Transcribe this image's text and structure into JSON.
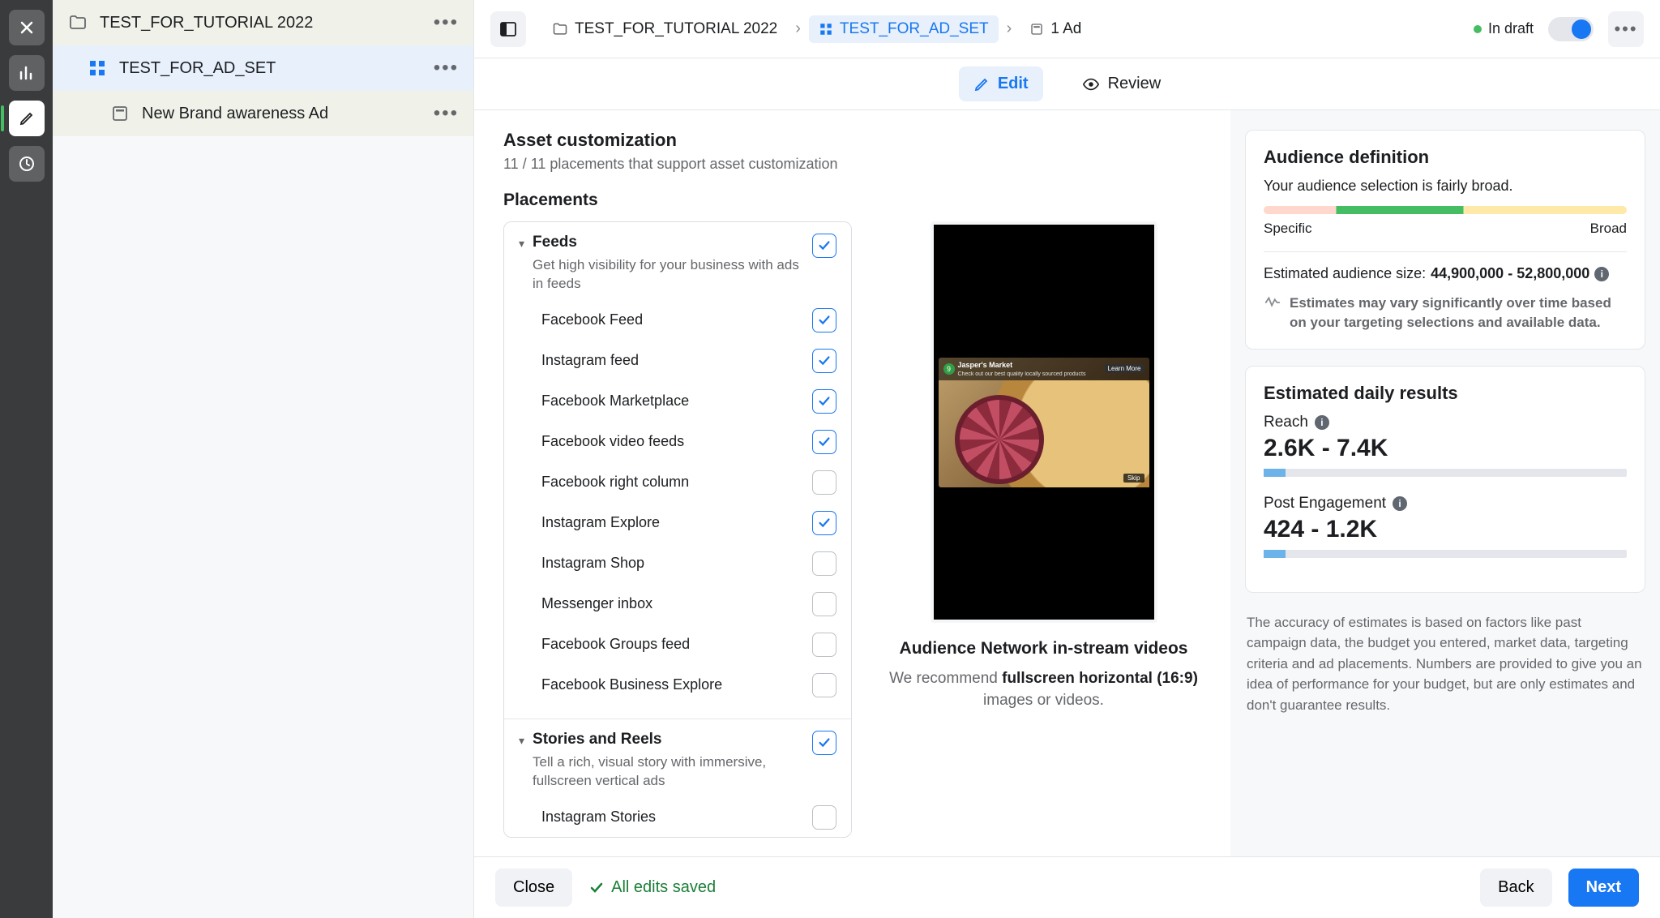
{
  "leftTree": {
    "campaign": "TEST_FOR_TUTORIAL 2022",
    "adset": "TEST_FOR_AD_SET",
    "ad": "New Brand awareness Ad"
  },
  "breadcrumb": {
    "campaign": "TEST_FOR_TUTORIAL 2022",
    "adset": "TEST_FOR_AD_SET",
    "ad": "1 Ad"
  },
  "status": {
    "label": "In draft"
  },
  "tabs": {
    "edit": "Edit",
    "review": "Review"
  },
  "section": {
    "title": "Asset customization",
    "sub": "11 / 11 placements that support asset customization",
    "placementsTitle": "Placements"
  },
  "groups": {
    "feeds": {
      "title": "Feeds",
      "desc": "Get high visibility for your business with ads in feeds",
      "items": {
        "fbFeed": "Facebook Feed",
        "igFeed": "Instagram feed",
        "fbMarketplace": "Facebook Marketplace",
        "fbVideoFeeds": "Facebook video feeds",
        "fbRightCol": "Facebook right column",
        "igExplore": "Instagram Explore",
        "igShop": "Instagram Shop",
        "msgInbox": "Messenger inbox",
        "fbGroups": "Facebook Groups feed",
        "fbBizExplore": "Facebook Business Explore"
      }
    },
    "stories": {
      "title": "Stories and Reels",
      "desc": "Tell a rich, visual story with immersive, fullscreen vertical ads",
      "items": {
        "igStories": "Instagram Stories"
      }
    }
  },
  "preview": {
    "title": "Audience Network in-stream videos",
    "hintPrefix": "We recommend ",
    "hintBold": "fullscreen horizontal (16:9)",
    "hintSuffix": " images or videos.",
    "brand": "Jasper's Market",
    "tagline": "Check out our best quality locally sourced products",
    "learnMore": "Learn More",
    "skip": "Skip"
  },
  "audience": {
    "title": "Audience definition",
    "note": "Your audience selection is fairly broad.",
    "specific": "Specific",
    "broad": "Broad",
    "estLabel": "Estimated audience size:",
    "estValue": "44,900,000 - 52,800,000",
    "warn": "Estimates may vary significantly over time based on your targeting selections and available data."
  },
  "results": {
    "title": "Estimated daily results",
    "reachLabel": "Reach",
    "reachValue": "2.6K - 7.4K",
    "engLabel": "Post Engagement",
    "engValue": "424 - 1.2K"
  },
  "disclaimer": "The accuracy of estimates is based on factors like past campaign data, the budget you entered, market data, targeting criteria and ad placements. Numbers are provided to give you an idea of performance for your budget, but are only estimates and don't guarantee results.",
  "footer": {
    "close": "Close",
    "saved": "All edits saved",
    "back": "Back",
    "next": "Next"
  }
}
